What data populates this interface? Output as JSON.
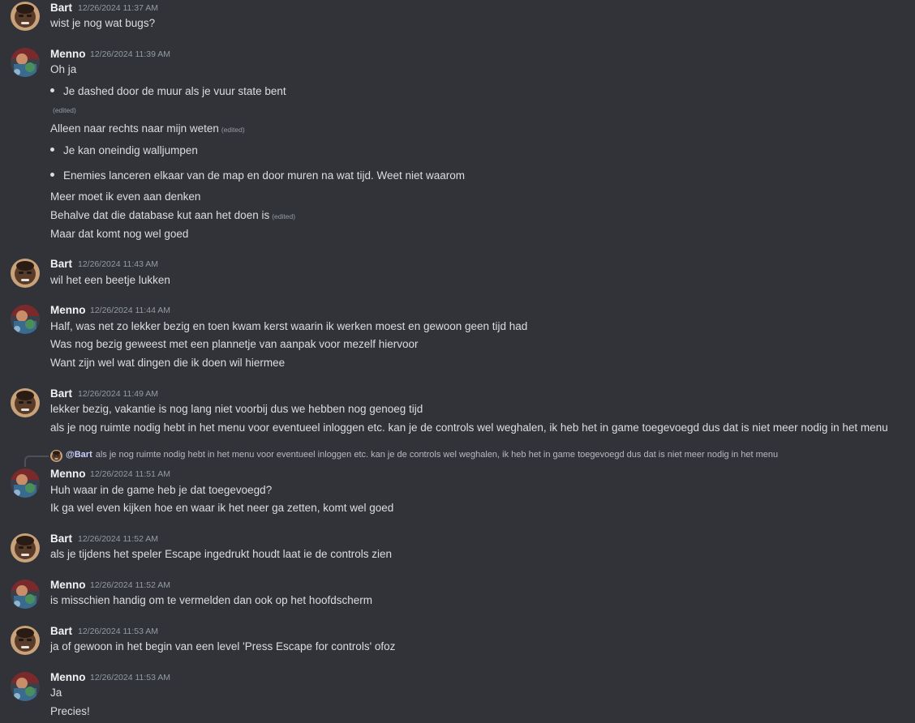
{
  "users": {
    "bart": "Bart",
    "menno": "Menno"
  },
  "messages": [
    {
      "author": "Bart",
      "time": "12/26/2024 11:37 AM",
      "lines": [
        "wist je nog wat bugs?"
      ]
    },
    {
      "author": "Menno",
      "time": "12/26/2024 11:39 AM",
      "lines": [
        "Oh ja",
        "Je dashed door de muur als je vuur state bent",
        "(edited)",
        "Alleen naar rechts naar mijn weten",
        "Je kan oneindig walljumpen",
        "Enemies lanceren elkaar van de map en door muren na wat tijd. Weet niet waarom",
        "Meer moet ik even aan denken",
        "Behalve dat die database kut aan het doen is",
        "Maar dat komt nog wel goed"
      ]
    },
    {
      "author": "Bart",
      "time": "12/26/2024 11:43 AM",
      "lines": [
        "wil het een beetje lukken"
      ]
    },
    {
      "author": "Menno",
      "time": "12/26/2024 11:44 AM",
      "lines": [
        "Half, was net zo lekker bezig en toen kwam kerst waarin ik werken moest en gewoon geen tijd had",
        "Was nog bezig geweest met een plannetje van aanpak voor mezelf hiervoor",
        "Want zijn wel wat dingen die ik doen wil hiermee"
      ]
    },
    {
      "author": "Bart",
      "time": "12/26/2024 11:49 AM",
      "lines": [
        "lekker bezig, vakantie is nog lang niet voorbij dus we hebben nog genoeg tijd",
        "als je nog ruimte nodig hebt in het menu voor eventueel inloggen etc. kan je de controls wel weghalen, ik heb het in game toegevoegd dus dat is niet meer nodig in het menu"
      ]
    },
    {
      "author": "Menno",
      "time": "12/26/2024 11:51 AM",
      "lines": [
        "Huh waar in de game heb je dat toegevoegd?",
        "Ik ga wel even kijken hoe en waar ik het neer ga zetten, komt wel goed"
      ]
    },
    {
      "author": "Bart",
      "time": "12/26/2024 11:52 AM",
      "lines": [
        "als je tijdens het speler Escape ingedrukt houdt laat ie de controls zien"
      ]
    },
    {
      "author": "Menno",
      "time": "12/26/2024 11:52 AM",
      "lines": [
        "is misschien handig om te vermelden dan ook op het hoofdscherm"
      ]
    },
    {
      "author": "Bart",
      "time": "12/26/2024 11:53 AM",
      "lines": [
        "ja of gewoon in het begin van een level 'Press Escape for controls' ofoz"
      ]
    },
    {
      "author": "Menno",
      "time": "12/26/2024 11:53 AM",
      "lines": [
        "Ja",
        "Precies!"
      ]
    }
  ],
  "edited_label": "(edited)",
  "reply": {
    "mention": "@Bart",
    "text": "als je nog ruimte nodig hebt in het menu voor eventueel inloggen etc. kan je de controls wel weghalen, ik heb het in game toegevoegd dus dat is niet meer nodig in het menu"
  },
  "colors": {
    "background": "#313338",
    "text": "#dbdee1",
    "muted": "#949ba4",
    "mention": "#c9cdfb"
  }
}
